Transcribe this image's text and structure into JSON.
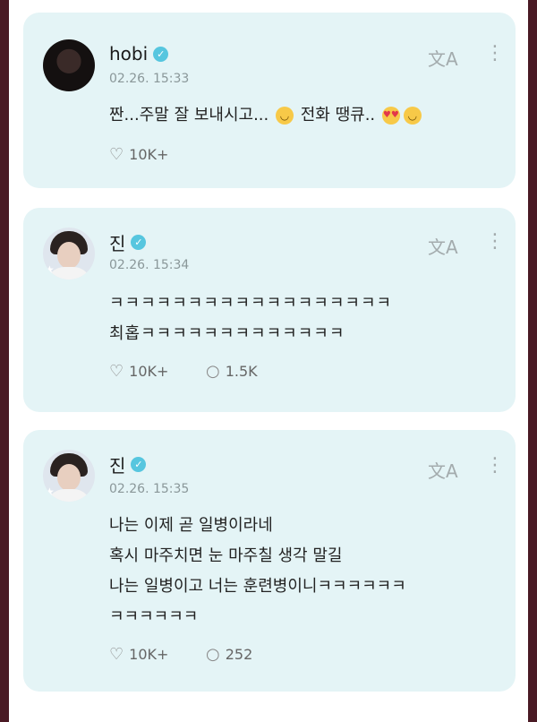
{
  "posts": [
    {
      "author": "hobi",
      "time": "02.26. 15:33",
      "text_before": "짠...주말 잘 보내시고...",
      "text_middle": "전화 땡큐..",
      "likes": "10K+",
      "translate_icon": "translate-icon",
      "more_icon": "more-vertical-icon"
    },
    {
      "author": "진",
      "time": "02.26. 15:34",
      "lines": [
        "ㅋㅋㅋㅋㅋㅋㅋㅋㅋㅋㅋㅋㅋㅋㅋㅋㅋㅋ",
        "최홉ㅋㅋㅋㅋㅋㅋㅋㅋㅋㅋㅋㅋㅋ"
      ],
      "likes": "10K+",
      "comments": "1.5K"
    },
    {
      "author": "진",
      "time": "02.26. 15:35",
      "lines": [
        "나는 이제 곧 일병이라네",
        "혹시 마주치면 눈 마주칠 생각 말길",
        "나는 일병이고 너는 훈련병이니ㅋㅋㅋㅋㅋㅋ",
        "ㅋㅋㅋㅋㅋㅋ"
      ],
      "likes": "10K+",
      "comments": "252"
    }
  ],
  "colors": {
    "card": "#e4f4f6",
    "verified": "#56c6df",
    "frame": "#4a1a24"
  }
}
